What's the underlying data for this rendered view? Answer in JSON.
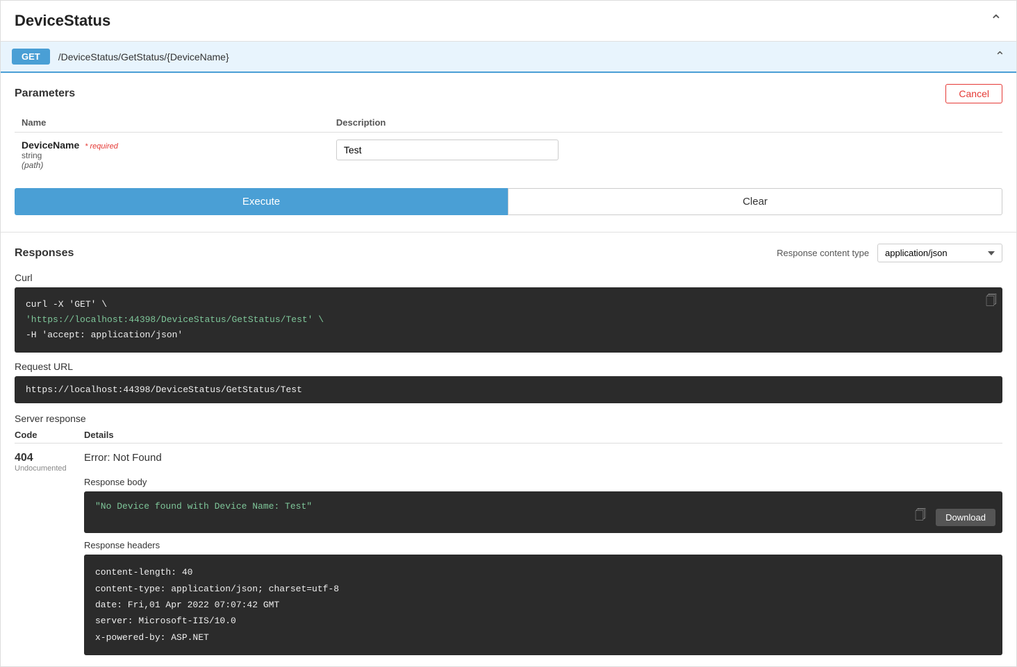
{
  "page": {
    "title": "DeviceStatus"
  },
  "get_bar": {
    "method": "GET",
    "path": "/DeviceStatus/GetStatus/{DeviceName}"
  },
  "parameters": {
    "section_title": "Parameters",
    "cancel_label": "Cancel",
    "col_name": "Name",
    "col_description": "Description",
    "param_name": "DeviceName",
    "required_label": "* required",
    "param_type": "string",
    "param_location": "(path)",
    "input_value": "Test",
    "input_placeholder": ""
  },
  "actions": {
    "execute_label": "Execute",
    "clear_label": "Clear"
  },
  "responses": {
    "section_title": "Responses",
    "content_type_label": "Response content type",
    "content_type_value": "application/json",
    "content_type_options": [
      "application/json"
    ]
  },
  "curl": {
    "label": "Curl",
    "line1": "curl -X 'GET' \\",
    "line2": "  'https://localhost:44398/DeviceStatus/GetStatus/Test' \\",
    "line3": "  -H 'accept: application/json'"
  },
  "request_url": {
    "label": "Request URL",
    "url": "https://localhost:44398/DeviceStatus/GetStatus/Test"
  },
  "server_response": {
    "label": "Server response",
    "col_code": "Code",
    "col_details": "Details",
    "code": "404",
    "undocumented": "Undocumented",
    "error_label": "Error: Not Found",
    "response_body_label": "Response body",
    "response_body": "\"No Device found with Device Name: Test\"",
    "download_label": "Download",
    "response_headers_label": "Response headers",
    "header_content_length": "content-length: 40",
    "header_content_type": "content-type: application/json; charset=utf-8",
    "header_date": "date: Fri,01 Apr 2022 07:07:42 GMT",
    "header_server": "server: Microsoft-IIS/10.0",
    "header_x_powered_by": "x-powered-by: ASP.NET"
  }
}
